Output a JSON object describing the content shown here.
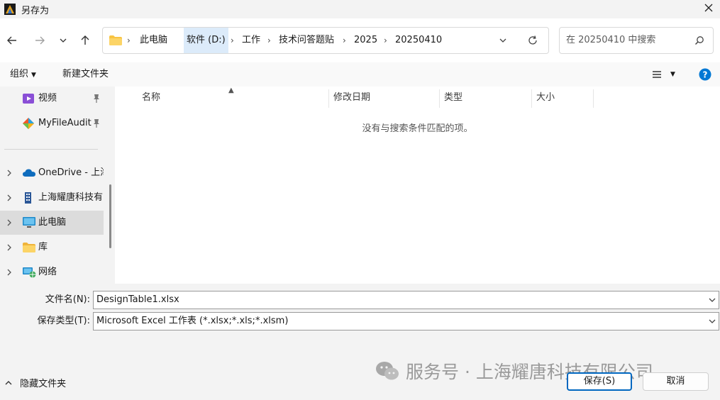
{
  "window": {
    "title": "另存为"
  },
  "address": {
    "crumbs": [
      "此电脑",
      "软件 (D:)",
      "工作",
      "技术问答题贴",
      "2025",
      "20250410"
    ]
  },
  "search": {
    "placeholder": "在 20250410 中搜索"
  },
  "toolbar": {
    "organize": "组织",
    "new_folder": "新建文件夹"
  },
  "nav": {
    "items": [
      {
        "label": "视频",
        "icon": "video-icon",
        "pinned": true
      },
      {
        "label": "MyFileAudit",
        "icon": "app-icon",
        "pinned": true
      },
      {
        "label": "OneDrive - 上海",
        "icon": "cloud-icon"
      },
      {
        "label": "上海耀唐科技有",
        "icon": "building-icon"
      },
      {
        "label": "此电脑",
        "icon": "computer-icon",
        "selected": true
      },
      {
        "label": "库",
        "icon": "folder-icon"
      },
      {
        "label": "网络",
        "icon": "network-icon"
      }
    ]
  },
  "columns": {
    "name": "名称",
    "modified": "修改日期",
    "type": "类型",
    "size": "大小"
  },
  "empty_message": "没有与搜索条件匹配的项。",
  "form": {
    "filename_label": "文件名(N):",
    "filename_value": "DesignTable1.xlsx",
    "filetype_label": "保存类型(T):",
    "filetype_value": "Microsoft Excel 工作表 (*.xlsx;*.xls;*.xlsm)"
  },
  "footer": {
    "hide_folders": "隐藏文件夹",
    "save": "保存(S)",
    "cancel": "取消",
    "watermark": "服务号 · 上海耀唐科技有限公司"
  },
  "colors": {
    "accent": "#0067c0",
    "selection": "#dcdcdc",
    "crumb_highlight": "#dcebfa"
  }
}
